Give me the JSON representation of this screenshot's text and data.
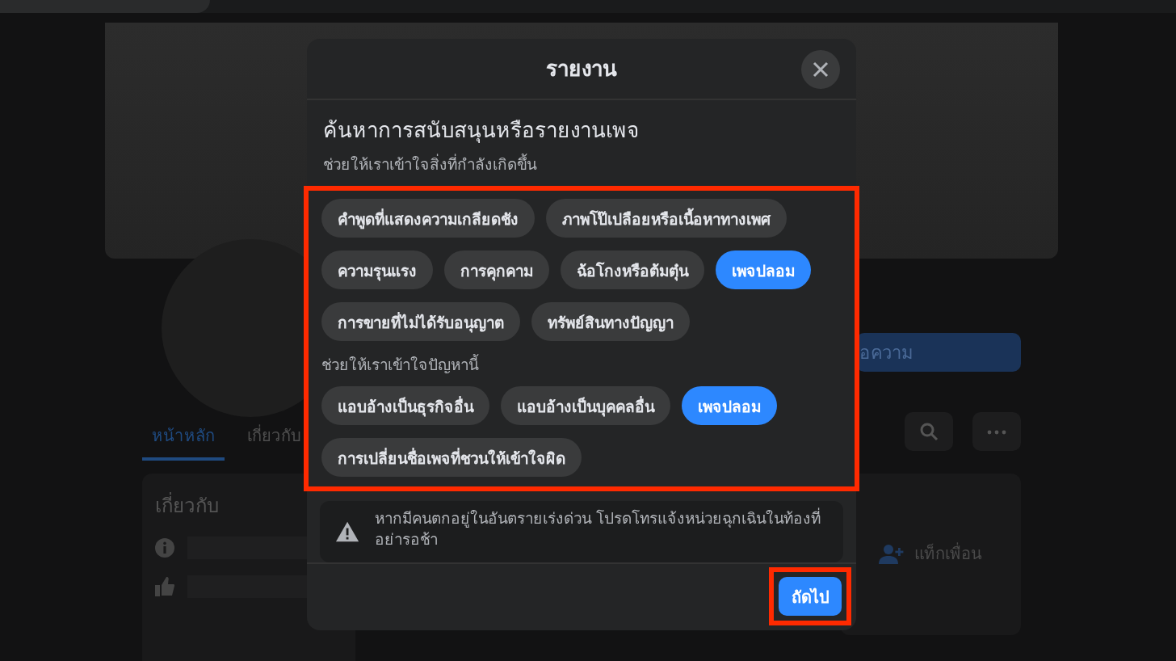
{
  "page": {
    "message_button": "อความ",
    "tabs": [
      {
        "label": "หน้าหลัก",
        "selected": true
      },
      {
        "label": "เกี่ยวกับ",
        "selected": false
      }
    ],
    "about_title": "เกี่ยวกับ",
    "tag_friends": "แท็กเพื่อน"
  },
  "modal": {
    "title": "รายงาน",
    "heading": "ค้นหาการสนับสนุนหรือรายงานเพจ",
    "subheading": "ช่วยให้เราเข้าใจสิ่งที่กำลังเกิดขึ้น",
    "groups": [
      {
        "options": [
          {
            "label": "คำพูดที่แสดงความเกลียดชัง",
            "selected": false
          },
          {
            "label": "ภาพโป๊เปลือยหรือเนื้อหาทางเพศ",
            "selected": false
          },
          {
            "label": "ความรุนแรง",
            "selected": false
          },
          {
            "label": "การคุกคาม",
            "selected": false
          },
          {
            "label": "ฉ้อโกงหรือต้มตุ๋น",
            "selected": false
          },
          {
            "label": "เพจปลอม",
            "selected": true
          },
          {
            "label": "การขายที่ไม่ได้รับอนุญาต",
            "selected": false
          },
          {
            "label": "ทรัพย์สินทางปัญญา",
            "selected": false
          }
        ]
      },
      {
        "label": "ช่วยให้เราเข้าใจปัญหานี้",
        "options": [
          {
            "label": "แอบอ้างเป็นธุรกิจอื่น",
            "selected": false
          },
          {
            "label": "แอบอ้างเป็นบุคคลอื่น",
            "selected": false
          },
          {
            "label": "เพจปลอม",
            "selected": true
          },
          {
            "label": "การเปลี่ยนชื่อเพจที่ชวนให้เข้าใจผิด",
            "selected": false
          }
        ]
      }
    ],
    "warning": "หากมีคนตกอยู่ในอันตรายเร่งด่วน โปรดโทรแจ้งหน่วยฉุกเฉินในท้องที่ อย่ารอช้า",
    "next_button": "ถัดไป"
  }
}
